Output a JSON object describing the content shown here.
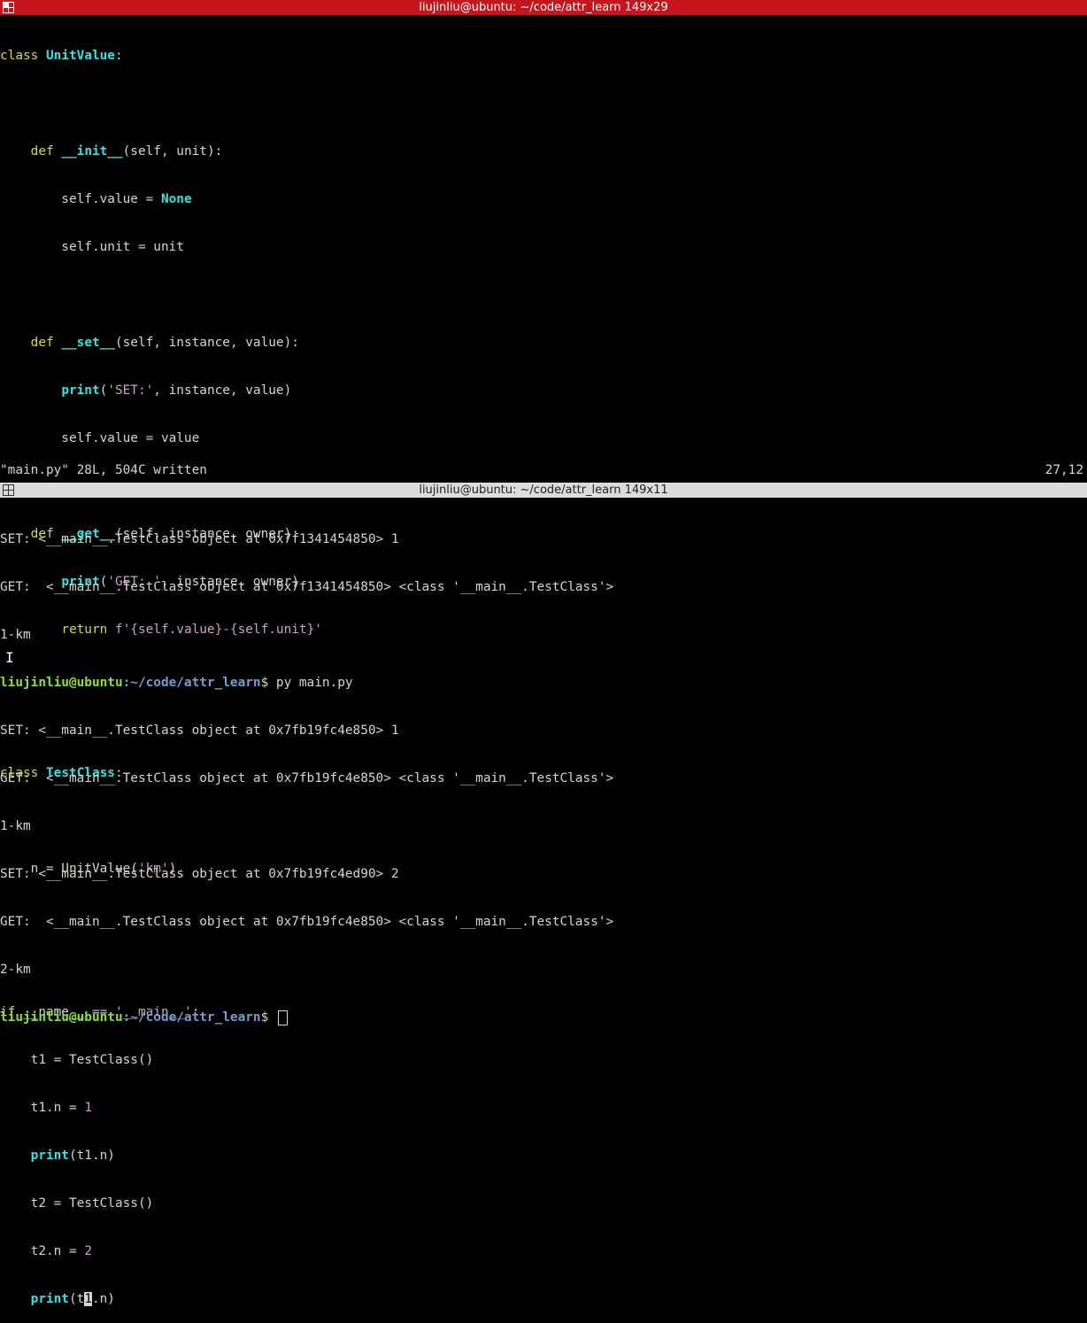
{
  "top_window": {
    "title": "liujinliu@ubuntu: ~/code/attr_learn 149x29"
  },
  "editor": {
    "lines": [
      "class UnitValue:",
      "",
      "    def __init__(self, unit):",
      "        self.value = None",
      "        self.unit = unit",
      "",
      "    def __set__(self, instance, value):",
      "        print('SET:', instance, value)",
      "        self.value = value",
      "",
      "    def __get__(self, instance, owner):",
      "        print('GET: ', instance, owner)",
      "        return f'{self.value}-{self.unit}'",
      "",
      "",
      "class TestClass:",
      "",
      "    n = UnitValue('km')",
      "",
      "",
      "if __name__ == '__main__':",
      "    t1 = TestClass()",
      "    t1.n = 1",
      "    print(t1.n)",
      "    t2 = TestClass()",
      "    t2.n = 2",
      "    print(t1.n)"
    ],
    "status_message": "\"main.py\" 28L, 504C written",
    "cursor_position": "27,12"
  },
  "bottom_window": {
    "title": "liujinliu@ubuntu: ~/code/attr_learn 149x11"
  },
  "terminal": {
    "prompt_user": "liujinliu@ubuntu",
    "prompt_path": ":~/code/attr_learn",
    "prompt_symbol": "$ ",
    "command": "py main.py",
    "output_before": [
      "SET: <__main__.TestClass object at 0x7f1341454850> 1",
      "GET:  <__main__.TestClass object at 0x7f1341454850> <class '__main__.TestClass'>",
      "1-km"
    ],
    "output_after": [
      "SET: <__main__.TestClass object at 0x7fb19fc4e850> 1",
      "GET:  <__main__.TestClass object at 0x7fb19fc4e850> <class '__main__.TestClass'>",
      "1-km",
      "SET: <__main__.TestClass object at 0x7fb19fc4ed90> 2",
      "GET:  <__main__.TestClass object at 0x7fb19fc4e850> <class '__main__.TestClass'>",
      "2-km"
    ]
  },
  "colors": {
    "title_active": "#c4161c",
    "title_inactive": "#dcdcdc",
    "prompt_user": "#8ae234",
    "prompt_path": "#729fcf"
  }
}
